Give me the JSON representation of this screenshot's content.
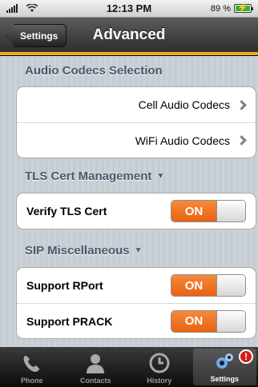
{
  "status_bar": {
    "time": "12:13 PM",
    "battery": "89 %",
    "battery_level": 0.89
  },
  "nav": {
    "back_label": "Settings",
    "title": "Advanced"
  },
  "sections": {
    "codecs": {
      "header": "Audio Codecs Selection",
      "items": [
        {
          "label": "Cell Audio Codecs"
        },
        {
          "label": "WiFi Audio Codecs"
        }
      ]
    },
    "tls": {
      "header": "TLS Cert Management",
      "items": [
        {
          "label": "Verify TLS Cert",
          "state": "ON"
        }
      ]
    },
    "sip": {
      "header": "SIP Miscellaneous",
      "items": [
        {
          "label": "Support RPort",
          "state": "ON"
        },
        {
          "label": "Support PRACK",
          "state": "ON"
        }
      ]
    }
  },
  "tabs": [
    {
      "label": "Phone",
      "icon": "phone-icon"
    },
    {
      "label": "Contacts",
      "icon": "contacts-icon"
    },
    {
      "label": "History",
      "icon": "clock-icon"
    },
    {
      "label": "Settings",
      "icon": "gears-icon",
      "badge": "!"
    }
  ],
  "colors": {
    "accent": "#f6a81c",
    "toggle_on": "#e8620f",
    "section_text": "#4c566c"
  }
}
